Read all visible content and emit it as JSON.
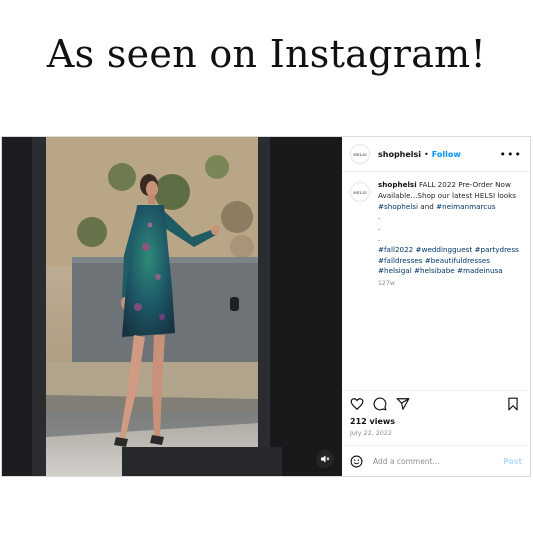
{
  "headline": "As seen on Instagram!",
  "post": {
    "avatar_text": "HELSI",
    "username": "shophelsi",
    "separator": "•",
    "follow_label": "Follow",
    "more_label": "•••",
    "caption_user": "shophelsi",
    "caption_text": "FALL 2022 Pre-Order Now Available...Shop our latest HELSI looks",
    "mention_1": "#shophelsi",
    "and_text": "and",
    "mention_2": "#neimanmarcus",
    "dots": [
      ".",
      ".",
      "."
    ],
    "hashtags": [
      "#fall2022",
      "#weddingguest",
      "#partydress",
      "#falldresses",
      "#beautifuldresses",
      "#helsigal",
      "#helsibabe",
      "#madeinusa"
    ],
    "age": "127w",
    "views": "212 views",
    "date": "July 22, 2022",
    "comment_placeholder": "Add a comment...",
    "post_label": "Post"
  },
  "icons": {
    "like": "heart-icon",
    "comment": "comment-icon",
    "share": "share-icon",
    "save": "bookmark-icon",
    "emoji": "emoji-icon",
    "mute": "speaker-muted-icon",
    "more": "more-options-icon"
  },
  "colors": {
    "link": "#0095f6",
    "hashtag": "#00376b",
    "post_disabled": "#b3dbff",
    "muted_text": "#8e8e8e"
  }
}
